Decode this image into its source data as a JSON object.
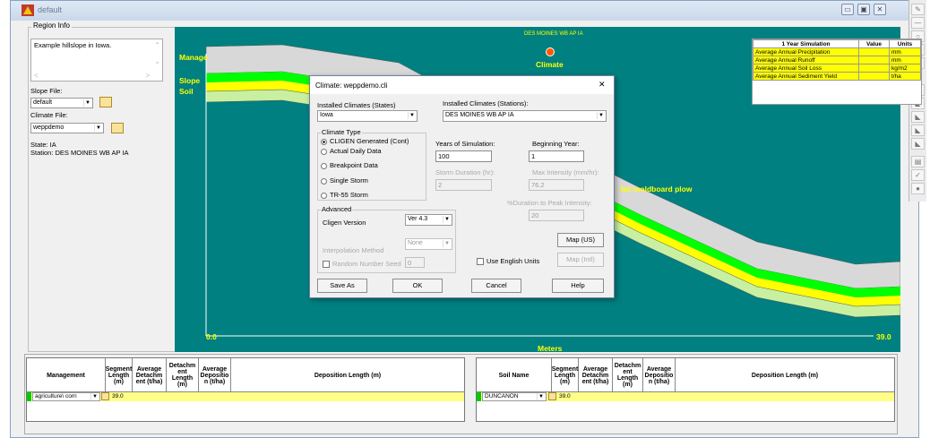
{
  "window": {
    "title": "default"
  },
  "region": {
    "legend": "Region Info",
    "description": "Example hillslope in Iowa.",
    "slope_file_label": "Slope File:",
    "slope_file_value": "default",
    "climate_file_label": "Climate File:",
    "climate_file_value": "weppdemo",
    "state_text": "State: IA",
    "station_text": "Station: DES MOINES WB AP IA"
  },
  "canvas": {
    "station_title": "DES MOINES WB AP IA",
    "climate_label": "Climate",
    "manage_label": "Manage",
    "slope_label": "Slope",
    "soil_label": "Soil",
    "management_desc": "- fall moldboard plow",
    "x_min": "0.0",
    "x_max": "39.0",
    "axis_label": "Meters"
  },
  "sim_table": {
    "headers": [
      "1 Year Simulation",
      "Value",
      "Units"
    ],
    "rows": [
      {
        "label": "Average Annual Precipitation",
        "value": "",
        "unit": "mm"
      },
      {
        "label": "Average Annual Runoff",
        "value": "",
        "unit": "mm"
      },
      {
        "label": "Average Annual Soil Loss",
        "value": "",
        "unit": "kg/m2"
      },
      {
        "label": "Average Annual Sediment Yield",
        "value": "",
        "unit": "t/ha"
      }
    ]
  },
  "dialog": {
    "title": "Climate: weppdemo.cli",
    "close": "✕",
    "states_label": "Installed Climates (States)",
    "states_value": "Iowa",
    "stations_label": "Installed Climates (Stations):",
    "stations_value": "DES MOINES WB AP IA",
    "climate_type_legend": "Climate Type",
    "climate_types": [
      "CLIGEN Generated (Cont)",
      "Actual Daily Data",
      "Breakpoint Data",
      "Single Storm",
      "TR-55 Storm"
    ],
    "years_label": "Years of Simulation:",
    "years_value": "100",
    "begin_label": "Beginning Year:",
    "begin_value": "1",
    "storm_duration_label": "Storm Duration (hr):",
    "storm_duration_value": "2",
    "max_intensity_label": "Max Intensity (mm/hr):",
    "max_intensity_value": "76.2",
    "duration_peak_label": "%Duration to Peak Intensity:",
    "duration_peak_value": "20",
    "advanced_legend": "Advanced",
    "cligen_label": "Cligen Version",
    "cligen_value": "Ver 4.3",
    "interp_label": "Interpolation Method",
    "interp_value": "None",
    "random_seed_label": "Random Number Seed",
    "random_seed_value": "0",
    "english_units_label": "Use English Units",
    "map_us": "Map (US)",
    "map_intl": "Map (Intl)",
    "save_as": "Save As",
    "ok": "OK",
    "cancel": "Cancel",
    "help": "Help"
  },
  "mgmt_grid": {
    "headers": [
      "Management",
      "Segment Length (m)",
      "Average Detachm ent (t/ha)",
      "Detachm ent Length (m)",
      "Average Depositio n (t/ha)",
      "Deposition Length (m)"
    ],
    "row_name": "agriculture\\ corn",
    "row_length": "39.0"
  },
  "soil_grid": {
    "headers": [
      "Soil Name",
      "Segment Length (m)",
      "Average Detachm ent (t/ha)",
      "Detachm ent Length (m)",
      "Average Depositio n (t/ha)",
      "Deposition Length (m)"
    ],
    "row_name": "DUNCANON",
    "row_length": "39.0"
  },
  "colors": {
    "canvas": "#008080",
    "label_yellow": "#ffff00",
    "cell_yellow": "#ffff00",
    "band_green": "#00ff00",
    "band_yellow": "#ffff00",
    "band_lightgreen": "#c8f0a0"
  }
}
